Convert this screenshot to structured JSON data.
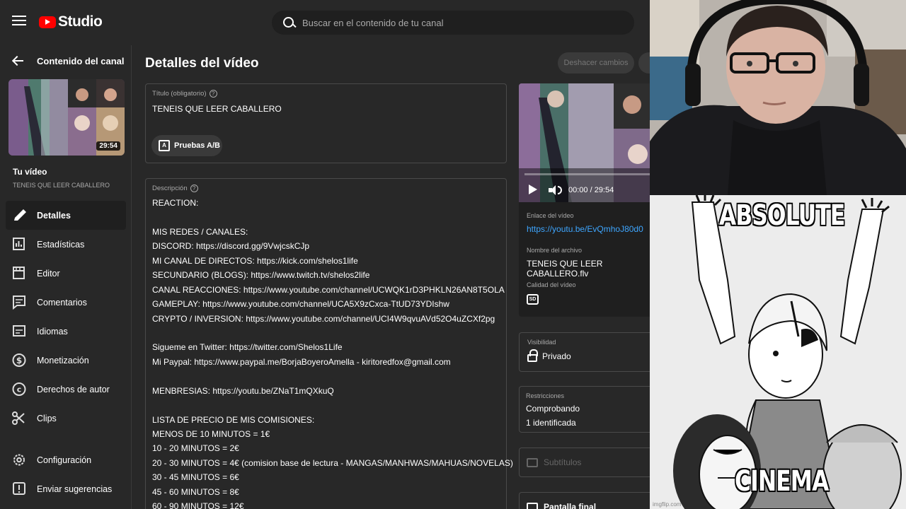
{
  "topbar": {
    "logo_text": "Studio",
    "search_placeholder": "Buscar en el contenido de tu canal"
  },
  "sidebar": {
    "back_label": "Contenido del canal",
    "thumb_duration": "29:54",
    "your_video_label": "Tu vídeo",
    "your_video_title": "TENEIS QUE LEER CABALLERO",
    "items": [
      {
        "label": "Detalles",
        "icon": "pencil-icon",
        "active": true
      },
      {
        "label": "Estadísticas",
        "icon": "analytics-icon"
      },
      {
        "label": "Editor",
        "icon": "editor-icon"
      },
      {
        "label": "Comentarios",
        "icon": "comments-icon"
      },
      {
        "label": "Idiomas",
        "icon": "subtitles-icon"
      },
      {
        "label": "Monetización",
        "icon": "dollar-icon"
      },
      {
        "label": "Derechos de autor",
        "icon": "copyright-icon"
      },
      {
        "label": "Clips",
        "icon": "scissors-icon"
      }
    ],
    "bottom_items": [
      {
        "label": "Configuración",
        "icon": "gear-icon"
      },
      {
        "label": "Enviar sugerencias",
        "icon": "feedback-icon"
      }
    ]
  },
  "main": {
    "page_title": "Detalles del vídeo",
    "undo_label": "Deshacer cambios",
    "title_field": {
      "label": "Título (obligatorio)",
      "value": "TENEIS QUE LEER CABALLERO",
      "ab_button": "Pruebas A/B"
    },
    "description_field": {
      "label": "Descripción",
      "lines": [
        "REACTION:",
        "",
        "MIS REDES / CANALES:",
        "DISCORD: https://discord.gg/9VwjcskCJp",
        "MI CANAL DE DIRECTOS: https://kick.com/shelos1life",
        "SECUNDARIO (BLOGS): https://www.twitch.tv/shelos2life",
        "CANAL REACCIONES: https://www.youtube.com/channel/UCWQK1rD3PHKLN26AN8T5OLA",
        "GAMEPLAY: https://www.youtube.com/channel/UCA5X9zCxca-TtUD73YDIshw",
        "CRYPTO / INVERSION: https://www.youtube.com/channel/UCI4W9qvuAVd52O4uZCXf2pg",
        "",
        "Sigueme en Twitter: https://twitter.com/Shelos1Life",
        "Mi Paypal: https://www.paypal.me/BorjaBoyeroAmella - kiritoredfox@gmail.com",
        "",
        "MENBRESIAS: https://youtu.be/ZNaT1mQXkuQ",
        "",
        "LISTA DE PRECIO DE MIS COMISIONES:",
        "MENOS DE 10 MINUTOS = 1€",
        "10 - 20 MINUTOS = 2€",
        "20 - 30 MINUTOS = 4€ (comision base de lectura - MANGAS/MANHWAS/MAHUAS/NOVELAS)",
        "30 - 45 MINUTOS = 6€",
        "45 - 60 MINUTOS = 8€",
        "60 - 90 MINUTOS = 12€"
      ]
    },
    "preview": {
      "time": "00:00 / 29:54",
      "link_label": "Enlace del vídeo",
      "link_value": "https://youtu.be/EvQmhoJ80d0",
      "file_label": "Nombre del archivo",
      "file_value": "TENEIS QUE LEER CABALLERO.flv",
      "quality_label": "Calidad del vídeo",
      "quality_badge": "SD"
    },
    "visibility": {
      "label": "Visibilidad",
      "value": "Privado"
    },
    "restrictions": {
      "label": "Restricciones",
      "line1": "Comprobando",
      "line2": "1 identificada"
    },
    "subtitles_label": "Subtítulos",
    "end_screen_label": "Pantalla final"
  },
  "meme": {
    "top_text": "ABSOLUTE",
    "bottom_text": "CINEMA",
    "watermark": "imgflip.com"
  },
  "colors": {
    "background": "#282828",
    "brand_red": "#ff0000",
    "link_blue": "#3ea6ff"
  }
}
